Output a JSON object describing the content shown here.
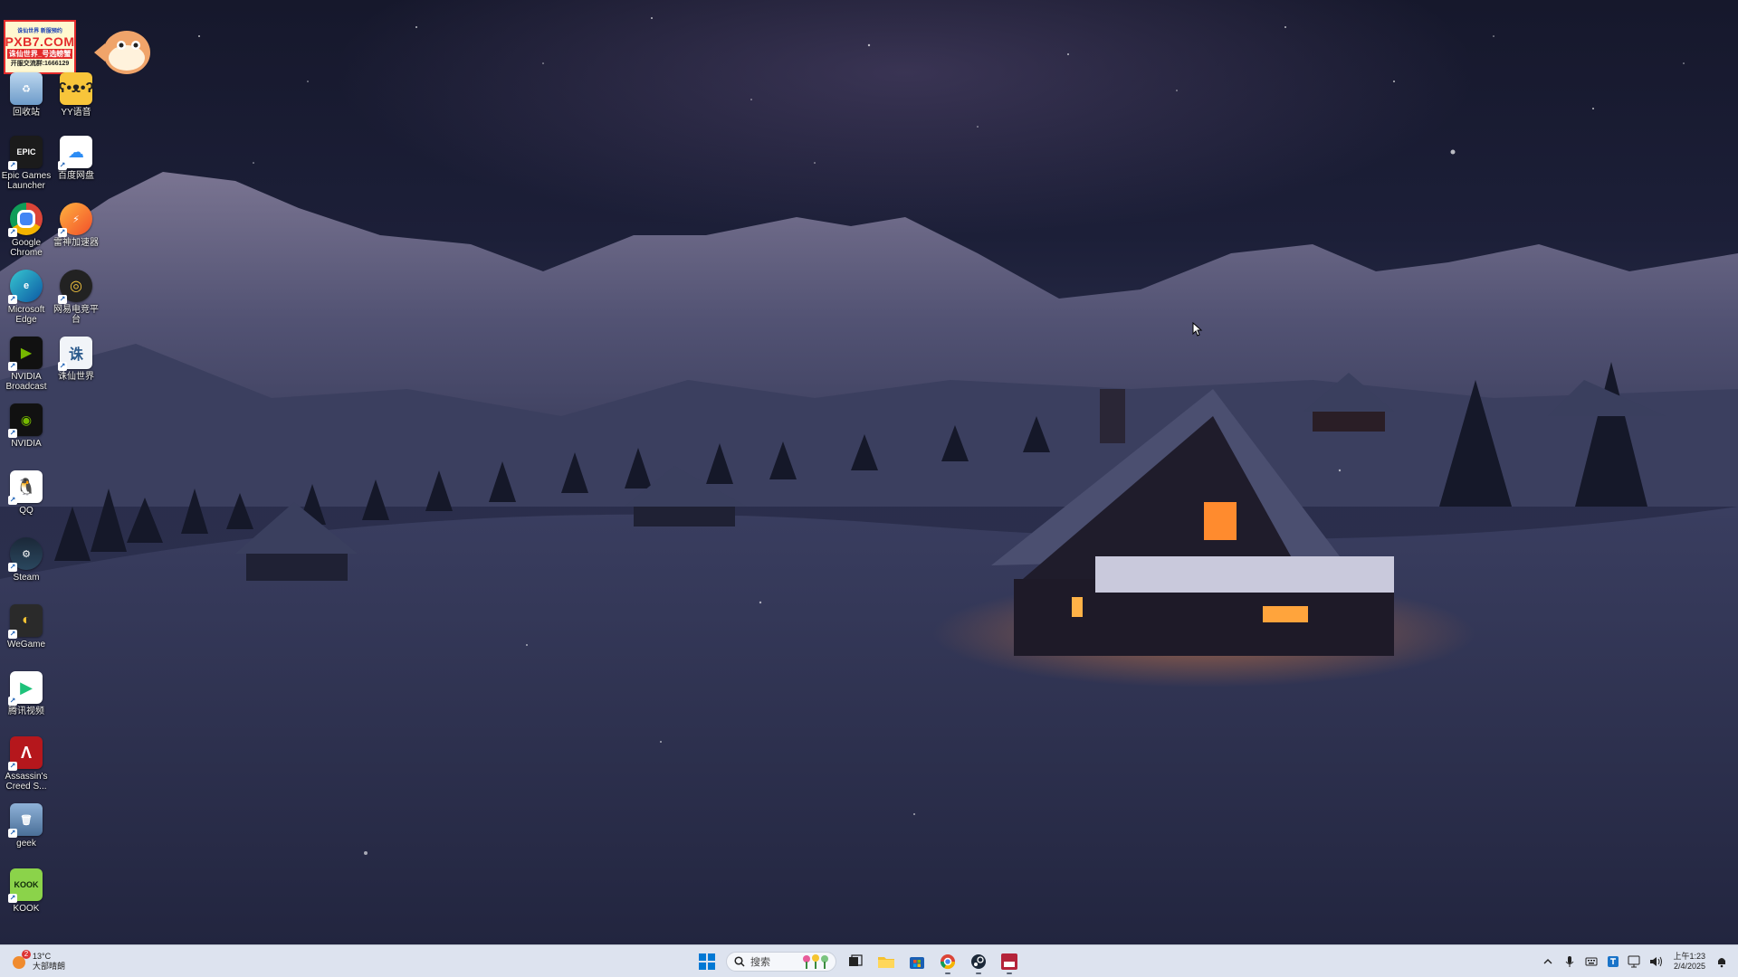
{
  "desktop_icons": [
    {
      "id": "recycle-bin",
      "label": "回收站"
    },
    {
      "id": "yy",
      "label": "YY语音"
    },
    {
      "id": "epic",
      "label": "Epic Games Launcher",
      "glyph": "EPIC"
    },
    {
      "id": "baidu-netdisk",
      "label": "百度网盘"
    },
    {
      "id": "chrome",
      "label": "Google Chrome"
    },
    {
      "id": "game-accelerator",
      "label": "雷神加速器"
    },
    {
      "id": "edge",
      "label": "Microsoft Edge"
    },
    {
      "id": "esports",
      "label": "网易电竞平台"
    },
    {
      "id": "nvidia-broadcast",
      "label": "NVIDIA Broadcast"
    },
    {
      "id": "zhuxian",
      "label": "诛仙世界"
    },
    {
      "id": "nvidia",
      "label": "NVIDIA"
    },
    {
      "id": "qq",
      "label": "QQ"
    },
    {
      "id": "steam",
      "label": "Steam"
    },
    {
      "id": "wegame",
      "label": "WeGame"
    },
    {
      "id": "tencent-video",
      "label": "腾讯视频"
    },
    {
      "id": "assassins-creed",
      "label": "Assassin's Creed S..."
    },
    {
      "id": "geek",
      "label": "geek"
    },
    {
      "id": "kook",
      "label": "KOOK",
      "glyph": "KOOK"
    }
  ],
  "ad_banner": {
    "line1": "诛仙世界 新服预约",
    "line2": "PXB7.COM",
    "line3": "诛仙世界_号选螃蟹",
    "line4": "开服交流群:1666129"
  },
  "taskbar": {
    "weather": {
      "temp": "13°C",
      "desc": "大部晴朗",
      "badge": "2"
    },
    "search_placeholder": "搜索",
    "clock": {
      "time": "上午1:23",
      "date": "2/4/2025"
    }
  },
  "colors": {
    "taskbar_bg": "#dde3ef",
    "windows_blue": "#0078d4"
  }
}
